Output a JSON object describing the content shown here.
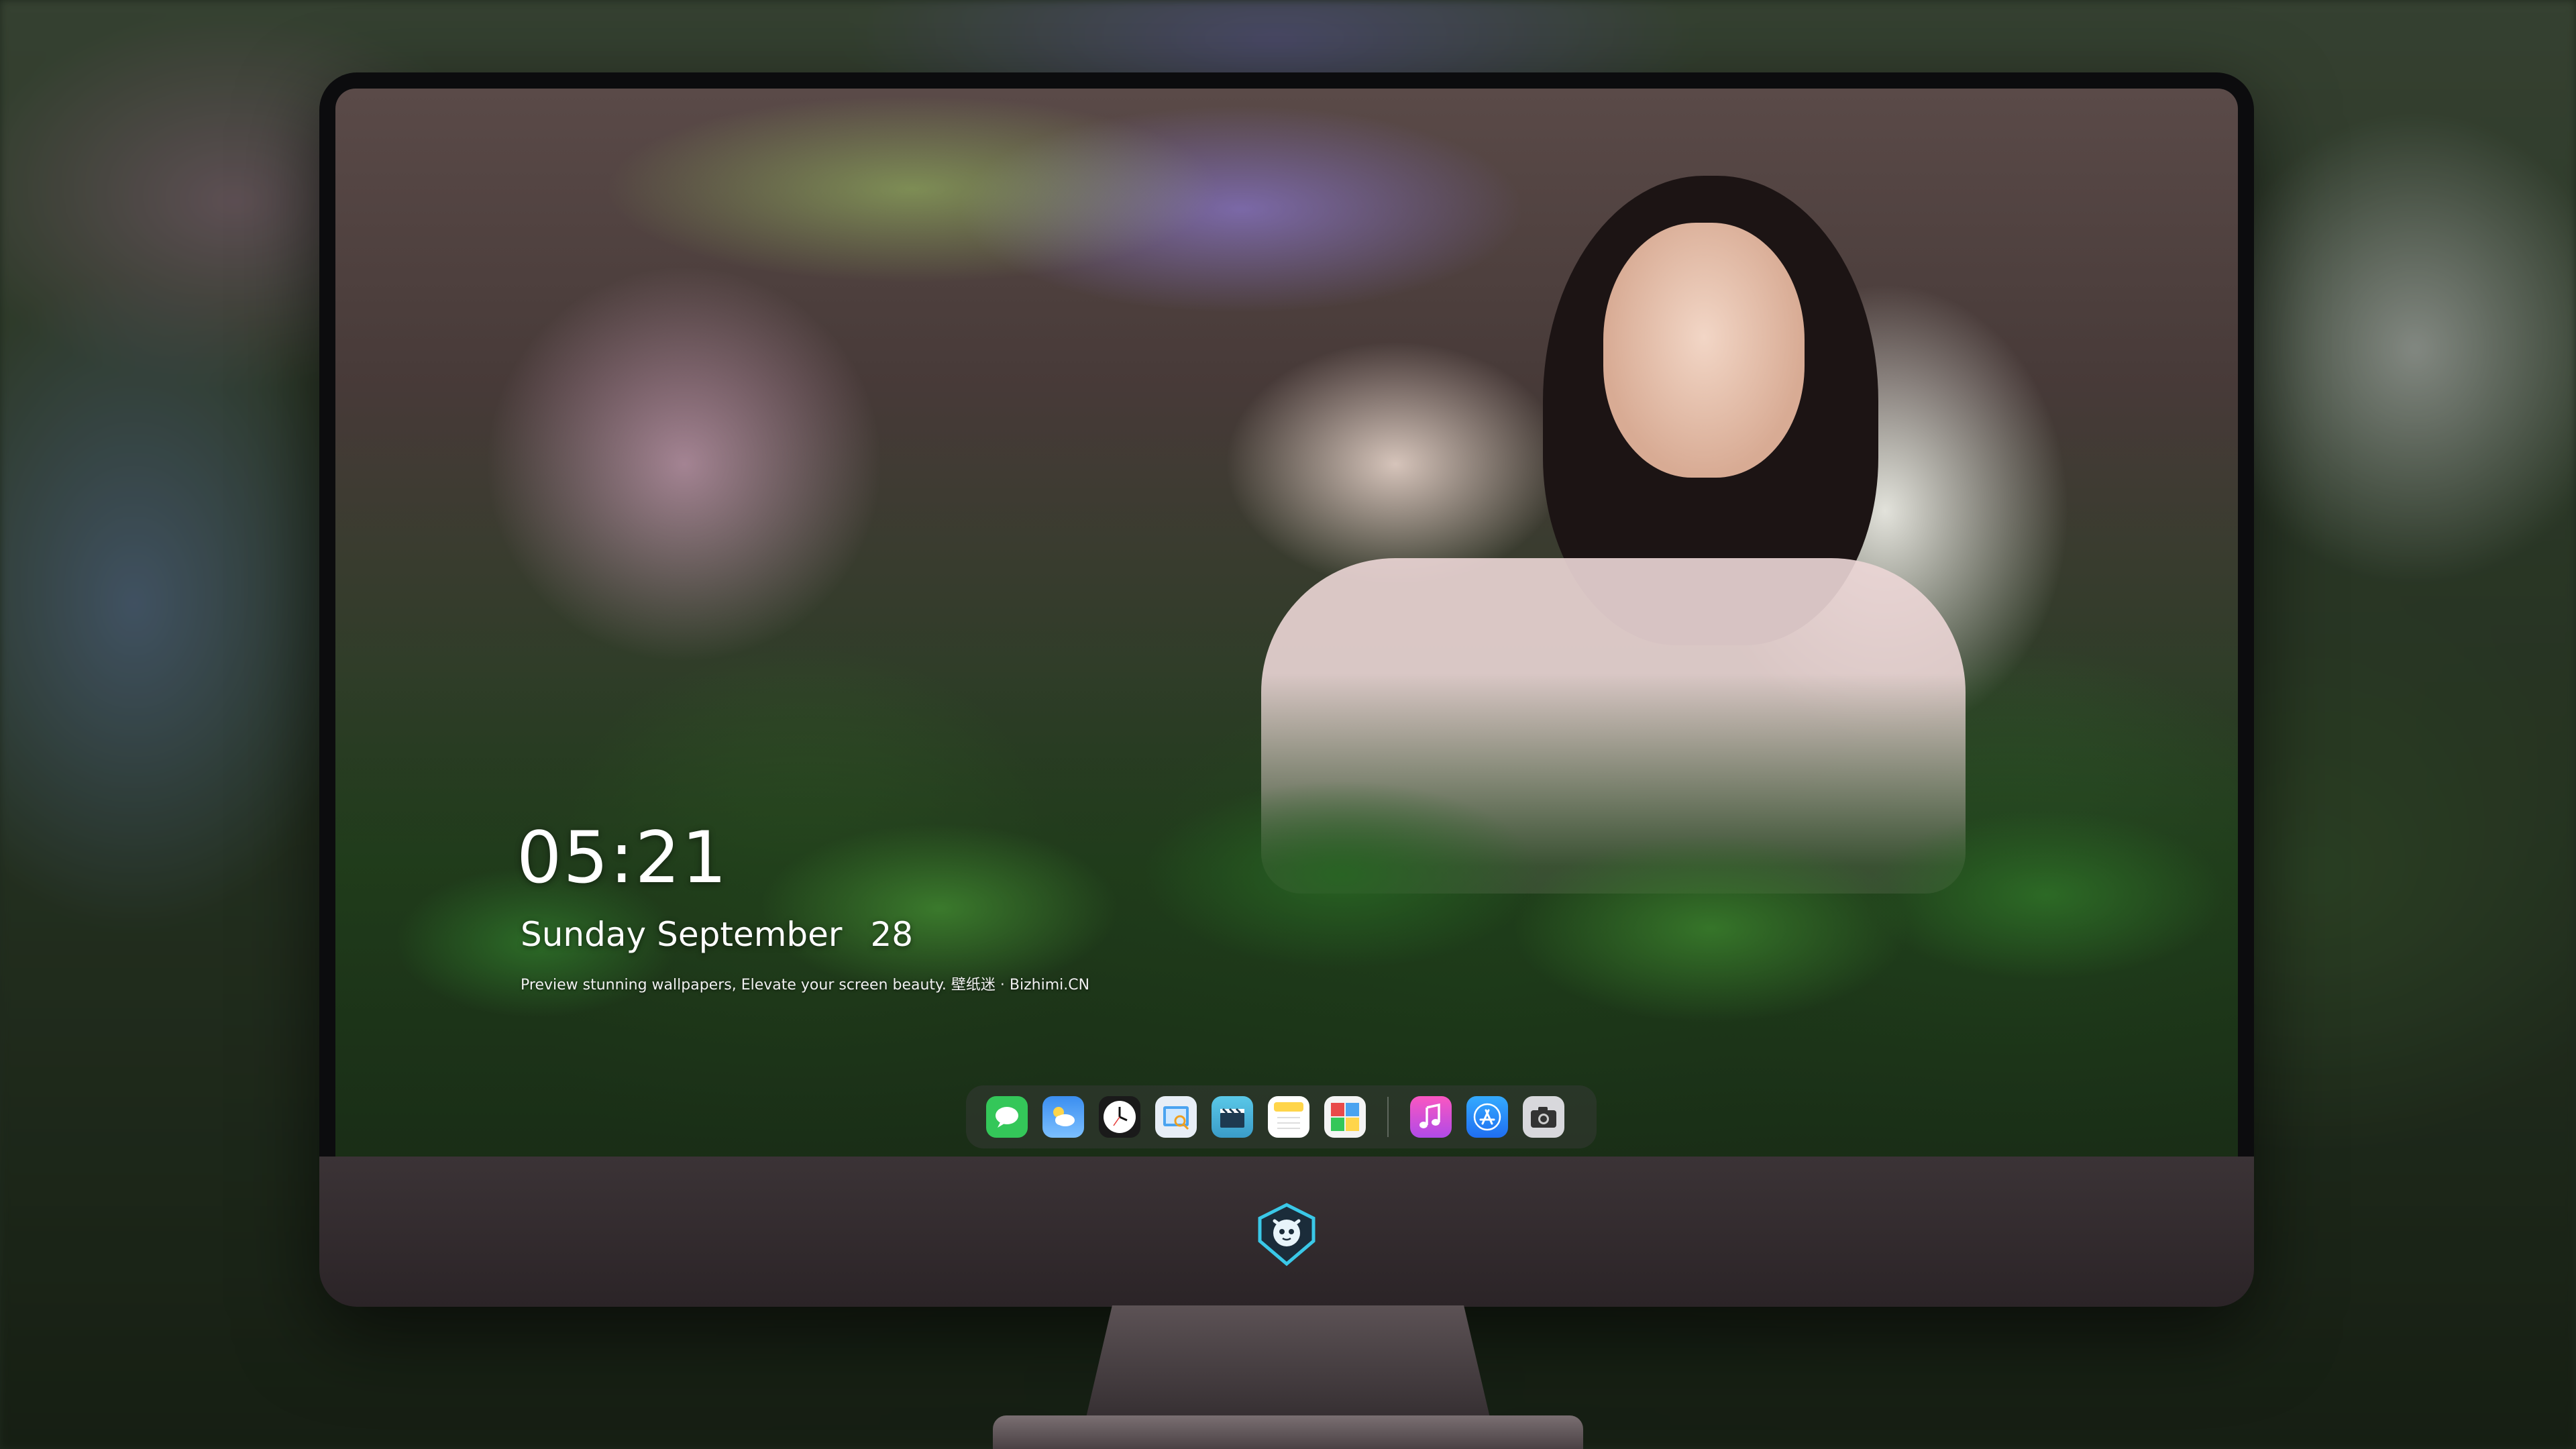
{
  "lockscreen": {
    "time": "05:21",
    "weekday": "Sunday",
    "month": "September",
    "day": "28",
    "tagline": "Preview stunning wallpapers, Elevate your screen beauty. 壁纸迷 · Bizhimi.CN"
  },
  "dock": {
    "apps": [
      {
        "name": "messages",
        "icon": "speech-bubble-icon",
        "color": "#34c759"
      },
      {
        "name": "weather",
        "icon": "cloud-sun-icon",
        "color": "#3b8ef0"
      },
      {
        "name": "clock",
        "icon": "clock-icon",
        "color": "#ffffff"
      },
      {
        "name": "preview",
        "icon": "photo-viewer-icon",
        "color": "#4aa3f0"
      },
      {
        "name": "final-cut",
        "icon": "clapperboard-icon",
        "color": "#5ac8e8"
      },
      {
        "name": "notes",
        "icon": "notes-icon",
        "color": "#ffd54a"
      },
      {
        "name": "photo-booth",
        "icon": "photo-booth-icon",
        "color": "#e84a4a"
      },
      {
        "name": "music",
        "icon": "music-note-icon",
        "color": "#fa57c1"
      },
      {
        "name": "app-store",
        "icon": "app-store-icon",
        "color": "#1f8ef1"
      },
      {
        "name": "camera",
        "icon": "camera-icon",
        "color": "#8e8e93"
      }
    ]
  },
  "brand": {
    "logo": "mascot-shield-logo",
    "accent": "#3ac8e8"
  }
}
